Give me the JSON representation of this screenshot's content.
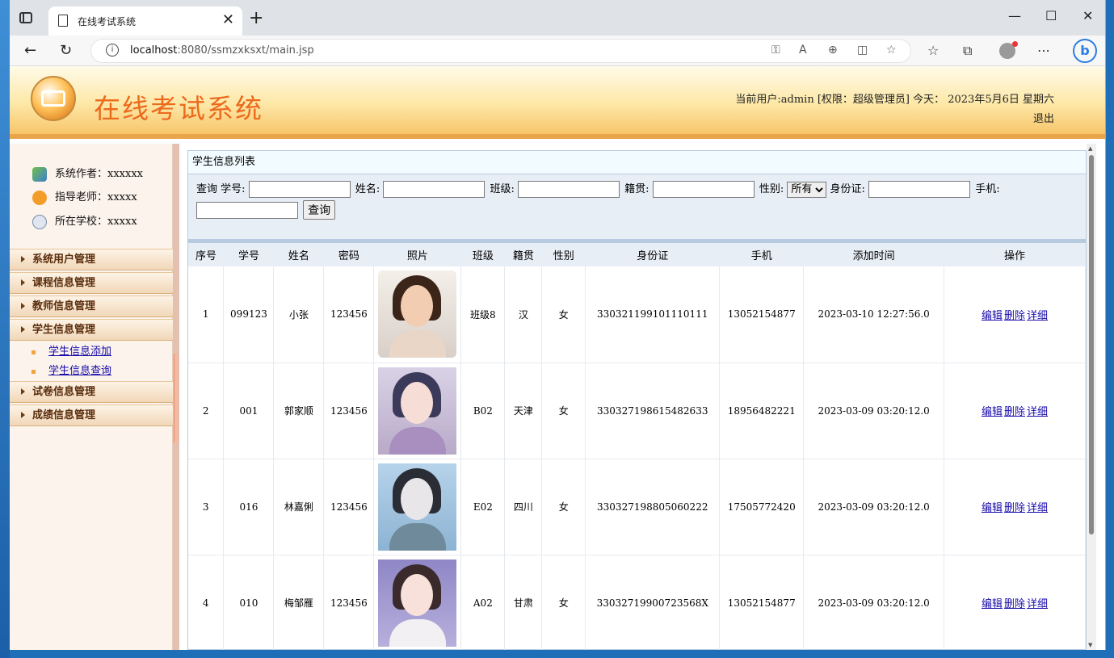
{
  "browser": {
    "tab_title": "在线考试系统",
    "url_host": "localhost",
    "url_rest": ":8080/ssmzxksxt/main.jsp"
  },
  "header": {
    "title": "在线考试系统",
    "userinfo": "当前用户:admin [权限：超级管理员] 今天： 2023年5月6日 星期六",
    "logout": "退出"
  },
  "sidebar": {
    "author": "系统作者：xxxxxx",
    "teacher": "指导老师：xxxxx",
    "school": "所在学校：xxxxx",
    "menu": [
      "系统用户管理",
      "课程信息管理",
      "教师信息管理",
      "学生信息管理",
      "试卷信息管理",
      "成绩信息管理"
    ],
    "student_sub": [
      "学生信息添加",
      "学生信息查询"
    ]
  },
  "panel": {
    "title": "学生信息列表"
  },
  "search": {
    "prefix": "查询",
    "label_no": "学号:",
    "label_name": "姓名:",
    "label_class": "班级:",
    "label_origin": "籍贯:",
    "label_gender": "性别:",
    "gender_value": "所有",
    "label_id": "身份证:",
    "label_phone": "手机:",
    "button": "查询"
  },
  "table": {
    "headers": [
      "序号",
      "学号",
      "姓名",
      "密码",
      "照片",
      "班级",
      "籍贯",
      "性别",
      "身份证",
      "手机",
      "添加时间",
      "操作"
    ],
    "rows": [
      {
        "idx": "1",
        "no": "099123",
        "name": "小张",
        "pwd": "123456",
        "cls": "班级8",
        "origin": "汉",
        "gender": "女",
        "id": "330321199101110111",
        "phone": "13052154877",
        "time": "2023-03-10 12:27:56.0"
      },
      {
        "idx": "2",
        "no": "001",
        "name": "郭家顺",
        "pwd": "123456",
        "cls": "B02",
        "origin": "天津",
        "gender": "女",
        "id": "330327198615482633",
        "phone": "18956482221",
        "time": "2023-03-09 03:20:12.0"
      },
      {
        "idx": "3",
        "no": "016",
        "name": "林嘉俐",
        "pwd": "123456",
        "cls": "E02",
        "origin": "四川",
        "gender": "女",
        "id": "330327198805060222",
        "phone": "17505772420",
        "time": "2023-03-09 03:20:12.0"
      },
      {
        "idx": "4",
        "no": "010",
        "name": "梅邹雁",
        "pwd": "123456",
        "cls": "A02",
        "origin": "甘肃",
        "gender": "女",
        "id": "33032719900723568X",
        "phone": "13052154877",
        "time": "2023-03-09 03:20:12.0"
      }
    ],
    "actions": {
      "edit": "编辑",
      "delete": "删除",
      "detail": "详细"
    }
  },
  "colors": {
    "title_orange": "#ec6a1c",
    "header_border": "#eaa54a",
    "link": "#1a0dab"
  }
}
